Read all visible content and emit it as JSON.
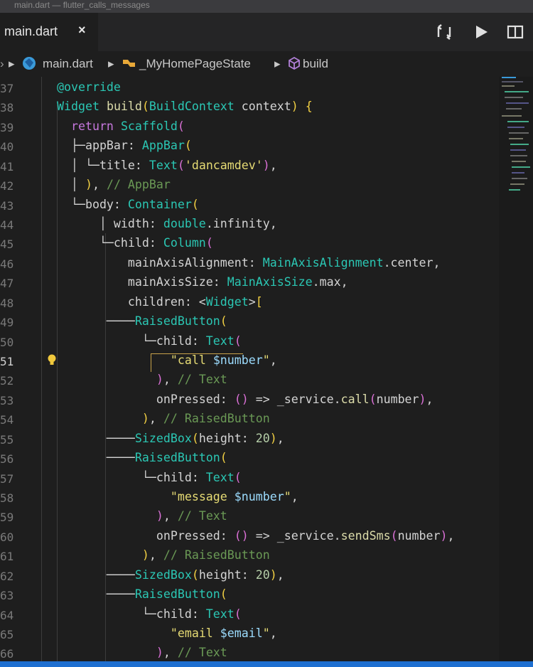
{
  "window": {
    "title": "main.dart — flutter_calls_messages"
  },
  "tabs": [
    {
      "label": "main.dart",
      "close": "×"
    }
  ],
  "breadcrumb": {
    "file": "main.dart",
    "class": "_MyHomePageState",
    "method": "build"
  },
  "gutter": [
    "37",
    "38",
    "39",
    "40",
    "41",
    "42",
    "43",
    "44",
    "45",
    "46",
    "47",
    "48",
    "49",
    "50",
    "51",
    "52",
    "53",
    "54",
    "55",
    "56",
    "57",
    "58",
    "59",
    "60",
    "61",
    "62",
    "63",
    "64",
    "65",
    "66"
  ],
  "colors": {
    "background": "#1e1e1e",
    "accent": "#1e6fd0"
  },
  "icons": {
    "toolbar": [
      "compare-changes-icon",
      "run-icon",
      "split-editor-icon"
    ]
  }
}
